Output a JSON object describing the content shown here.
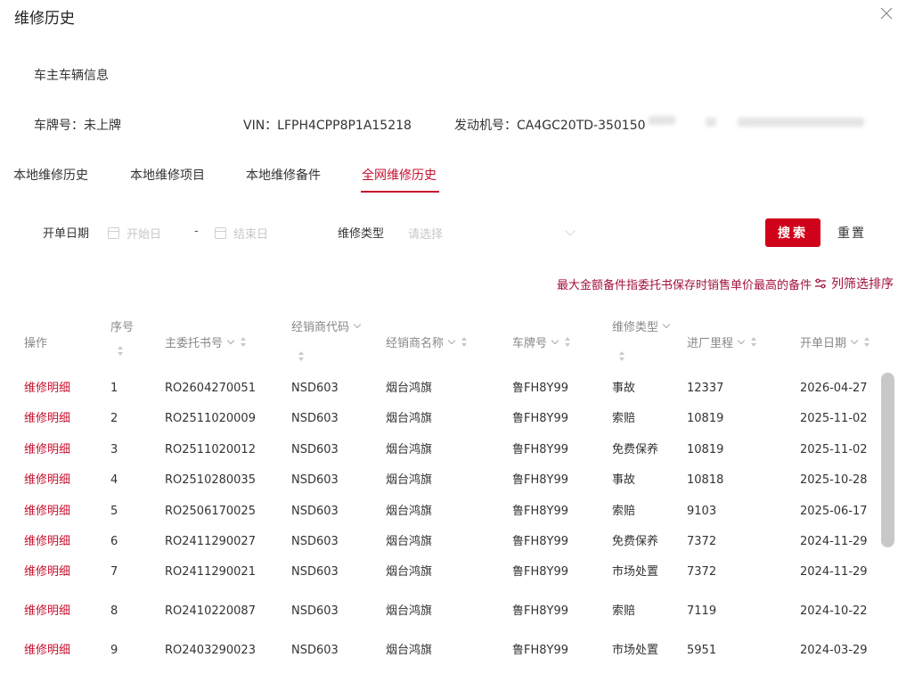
{
  "modal": {
    "title": "维修历史"
  },
  "owner_info": {
    "section_title": "车主车辆信息",
    "plate": "车牌号：未上牌",
    "vin": "VIN：LFPH4CPP8P1A15218",
    "engine": "发动机号：CA4GC20TD-350150"
  },
  "tabs": [
    {
      "label": "本地维修历史"
    },
    {
      "label": "本地维修项目"
    },
    {
      "label": "本地维修备件"
    },
    {
      "label": "全网维修历史"
    }
  ],
  "active_tab": 3,
  "filters": {
    "date_label": "开单日期",
    "start_placeholder": "开始日",
    "separator": "-",
    "end_placeholder": "结束日",
    "type_label": "维修类型",
    "type_placeholder": "请选择",
    "search_label": "搜索",
    "reset_label": "重置"
  },
  "notice": "最大金额备件指委托书保存时销售单价最高的备件",
  "filter_sort_label": "列筛选排序",
  "table": {
    "headers": {
      "op": "操作",
      "seq": "序号",
      "ro": "主委托书号",
      "dealer_code": "经销商代码",
      "dealer_name": "经销商名称",
      "plate": "车牌号",
      "repair_type": "维修类型",
      "mileage": "进厂里程",
      "date": "开单日期"
    },
    "rows": [
      {
        "op": "维修明细",
        "seq": "1",
        "ro": "RO2604270051",
        "dealer_code": "NSD603",
        "dealer_name": "烟台鸿旗",
        "plate": "鲁FH8Y99",
        "repair_type": "事故",
        "mileage": "12337",
        "date": "2026-04-27"
      },
      {
        "op": "维修明细",
        "seq": "2",
        "ro": "RO2511020009",
        "dealer_code": "NSD603",
        "dealer_name": "烟台鸿旗",
        "plate": "鲁FH8Y99",
        "repair_type": "索赔",
        "mileage": "10819",
        "date": "2025-11-02"
      },
      {
        "op": "维修明细",
        "seq": "3",
        "ro": "RO2511020012",
        "dealer_code": "NSD603",
        "dealer_name": "烟台鸿旗",
        "plate": "鲁FH8Y99",
        "repair_type": "免费保养",
        "mileage": "10819",
        "date": "2025-11-02"
      },
      {
        "op": "维修明细",
        "seq": "4",
        "ro": "RO2510280035",
        "dealer_code": "NSD603",
        "dealer_name": "烟台鸿旗",
        "plate": "鲁FH8Y99",
        "repair_type": "事故",
        "mileage": "10818",
        "date": "2025-10-28"
      },
      {
        "op": "维修明细",
        "seq": "5",
        "ro": "RO2506170025",
        "dealer_code": "NSD603",
        "dealer_name": "烟台鸿旗",
        "plate": "鲁FH8Y99",
        "repair_type": "索赔",
        "mileage": "9103",
        "date": "2025-06-17"
      },
      {
        "op": "维修明细",
        "seq": "6",
        "ro": "RO2411290027",
        "dealer_code": "NSD603",
        "dealer_name": "烟台鸿旗",
        "plate": "鲁FH8Y99",
        "repair_type": "免费保养",
        "mileage": "7372",
        "date": "2024-11-29"
      },
      {
        "op": "维修明细",
        "seq": "7",
        "ro": "RO2411290021",
        "dealer_code": "NSD603",
        "dealer_name": "烟台鸿旗",
        "plate": "鲁FH8Y99",
        "repair_type": "市场处置",
        "mileage": "7372",
        "date": "2024-11-29"
      },
      {
        "op": "维修明细",
        "seq": "8",
        "ro": "RO2410220087",
        "dealer_code": "NSD603",
        "dealer_name": "烟台鸿旗",
        "plate": "鲁FH8Y99",
        "repair_type": "索赔",
        "mileage": "7119",
        "date": "2024-10-22"
      },
      {
        "op": "维修明细",
        "seq": "9",
        "ro": "RO2403290023",
        "dealer_code": "NSD603",
        "dealer_name": "烟台鸿旗",
        "plate": "鲁FH8Y99",
        "repair_type": "市场处置",
        "mileage": "5951",
        "date": "2024-03-29"
      }
    ]
  },
  "colors": {
    "accent": "#c8102e",
    "button": "#d0021b",
    "notice": "#a3123a"
  }
}
